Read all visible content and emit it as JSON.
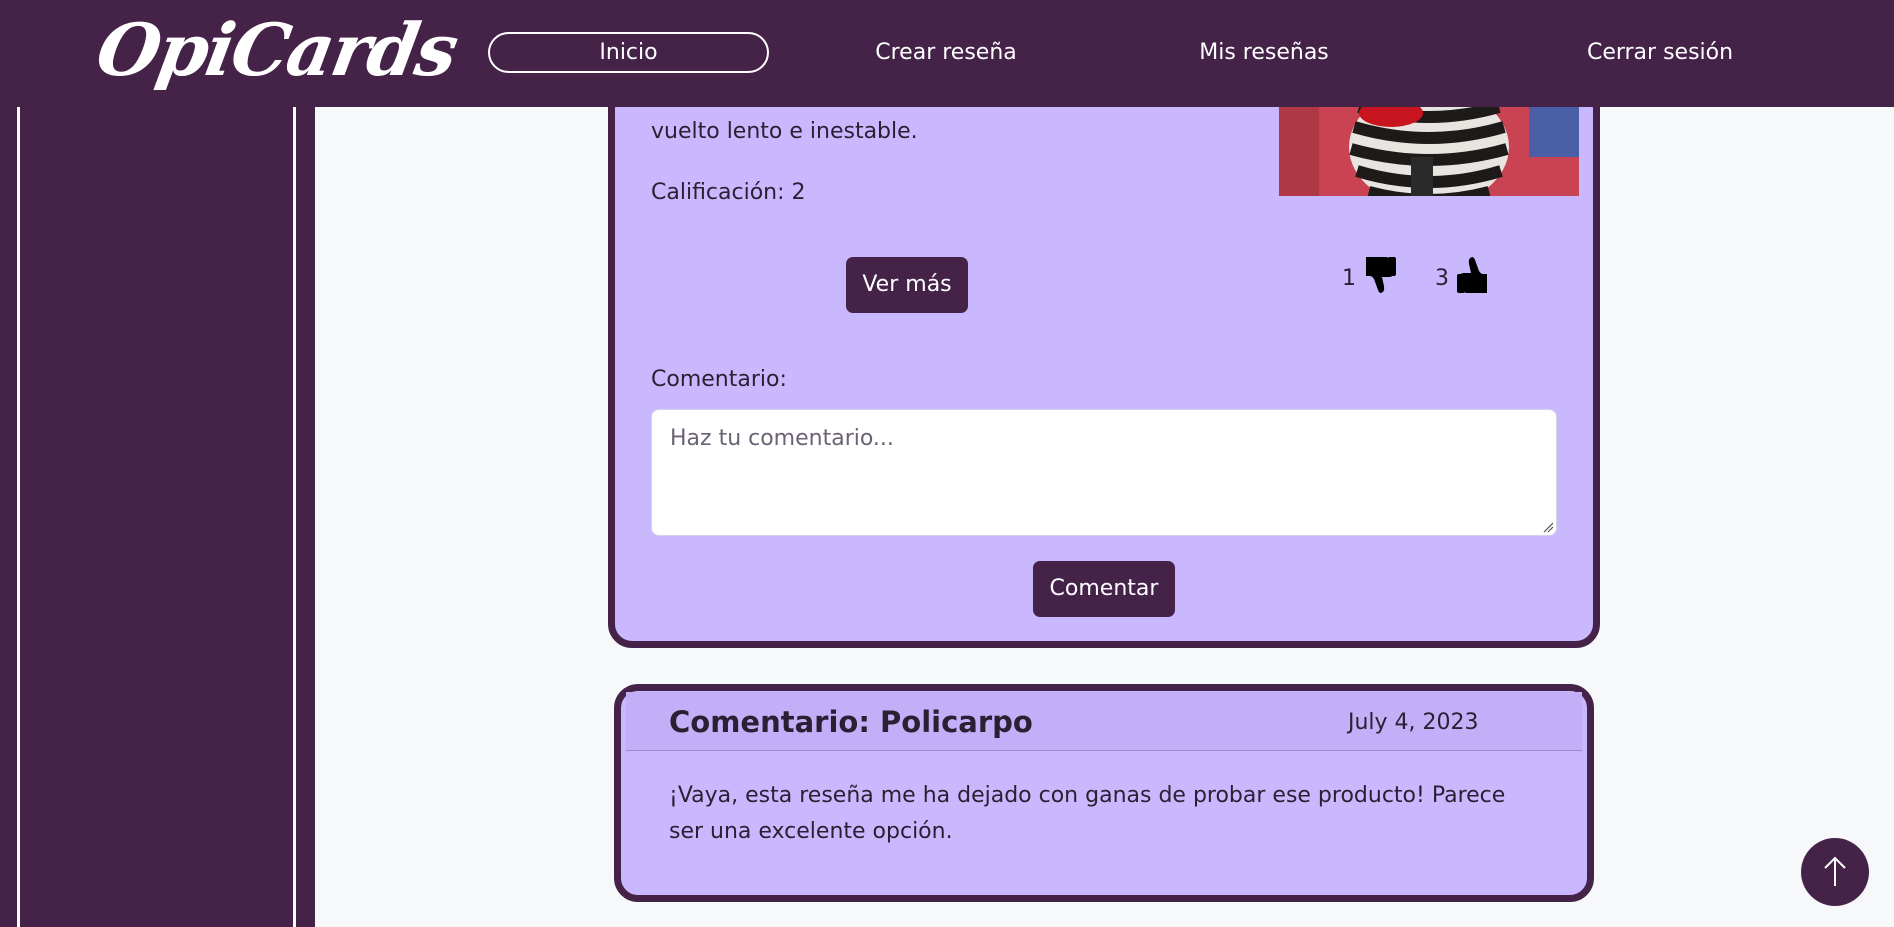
{
  "header": {
    "logo": "OpiCards",
    "nav": {
      "inicio": "Inicio",
      "crear": "Crear reseña",
      "mis": "Mis reseñas",
      "cerrar": "Cerrar sesión"
    }
  },
  "review": {
    "text_visible": "vuelto lento e inestable.",
    "rating_label": "Calificación: 2",
    "rating": 2,
    "ver_mas": "Ver más",
    "dislikes": "1",
    "likes": "3",
    "comment_label": "Comentario:",
    "comment_placeholder": "Haz tu comentario...",
    "comment_value": "",
    "submit_label": "Comentar"
  },
  "comments": [
    {
      "author_line": "Comentario: Policarpo",
      "date": "July 4, 2023",
      "body": "¡Vaya, esta reseña me ha dejado con ganas de probar ese producto! Parece ser una excelente opción."
    }
  ],
  "colors": {
    "primary": "#452349",
    "card": "#c9b8fe",
    "card_header": "#c1b0f7",
    "page": "#f7f8fa"
  },
  "icons": {
    "thumbs_down": "thumbs-down-icon",
    "thumbs_up": "thumbs-up-icon",
    "scroll_top": "arrow-up-icon"
  }
}
